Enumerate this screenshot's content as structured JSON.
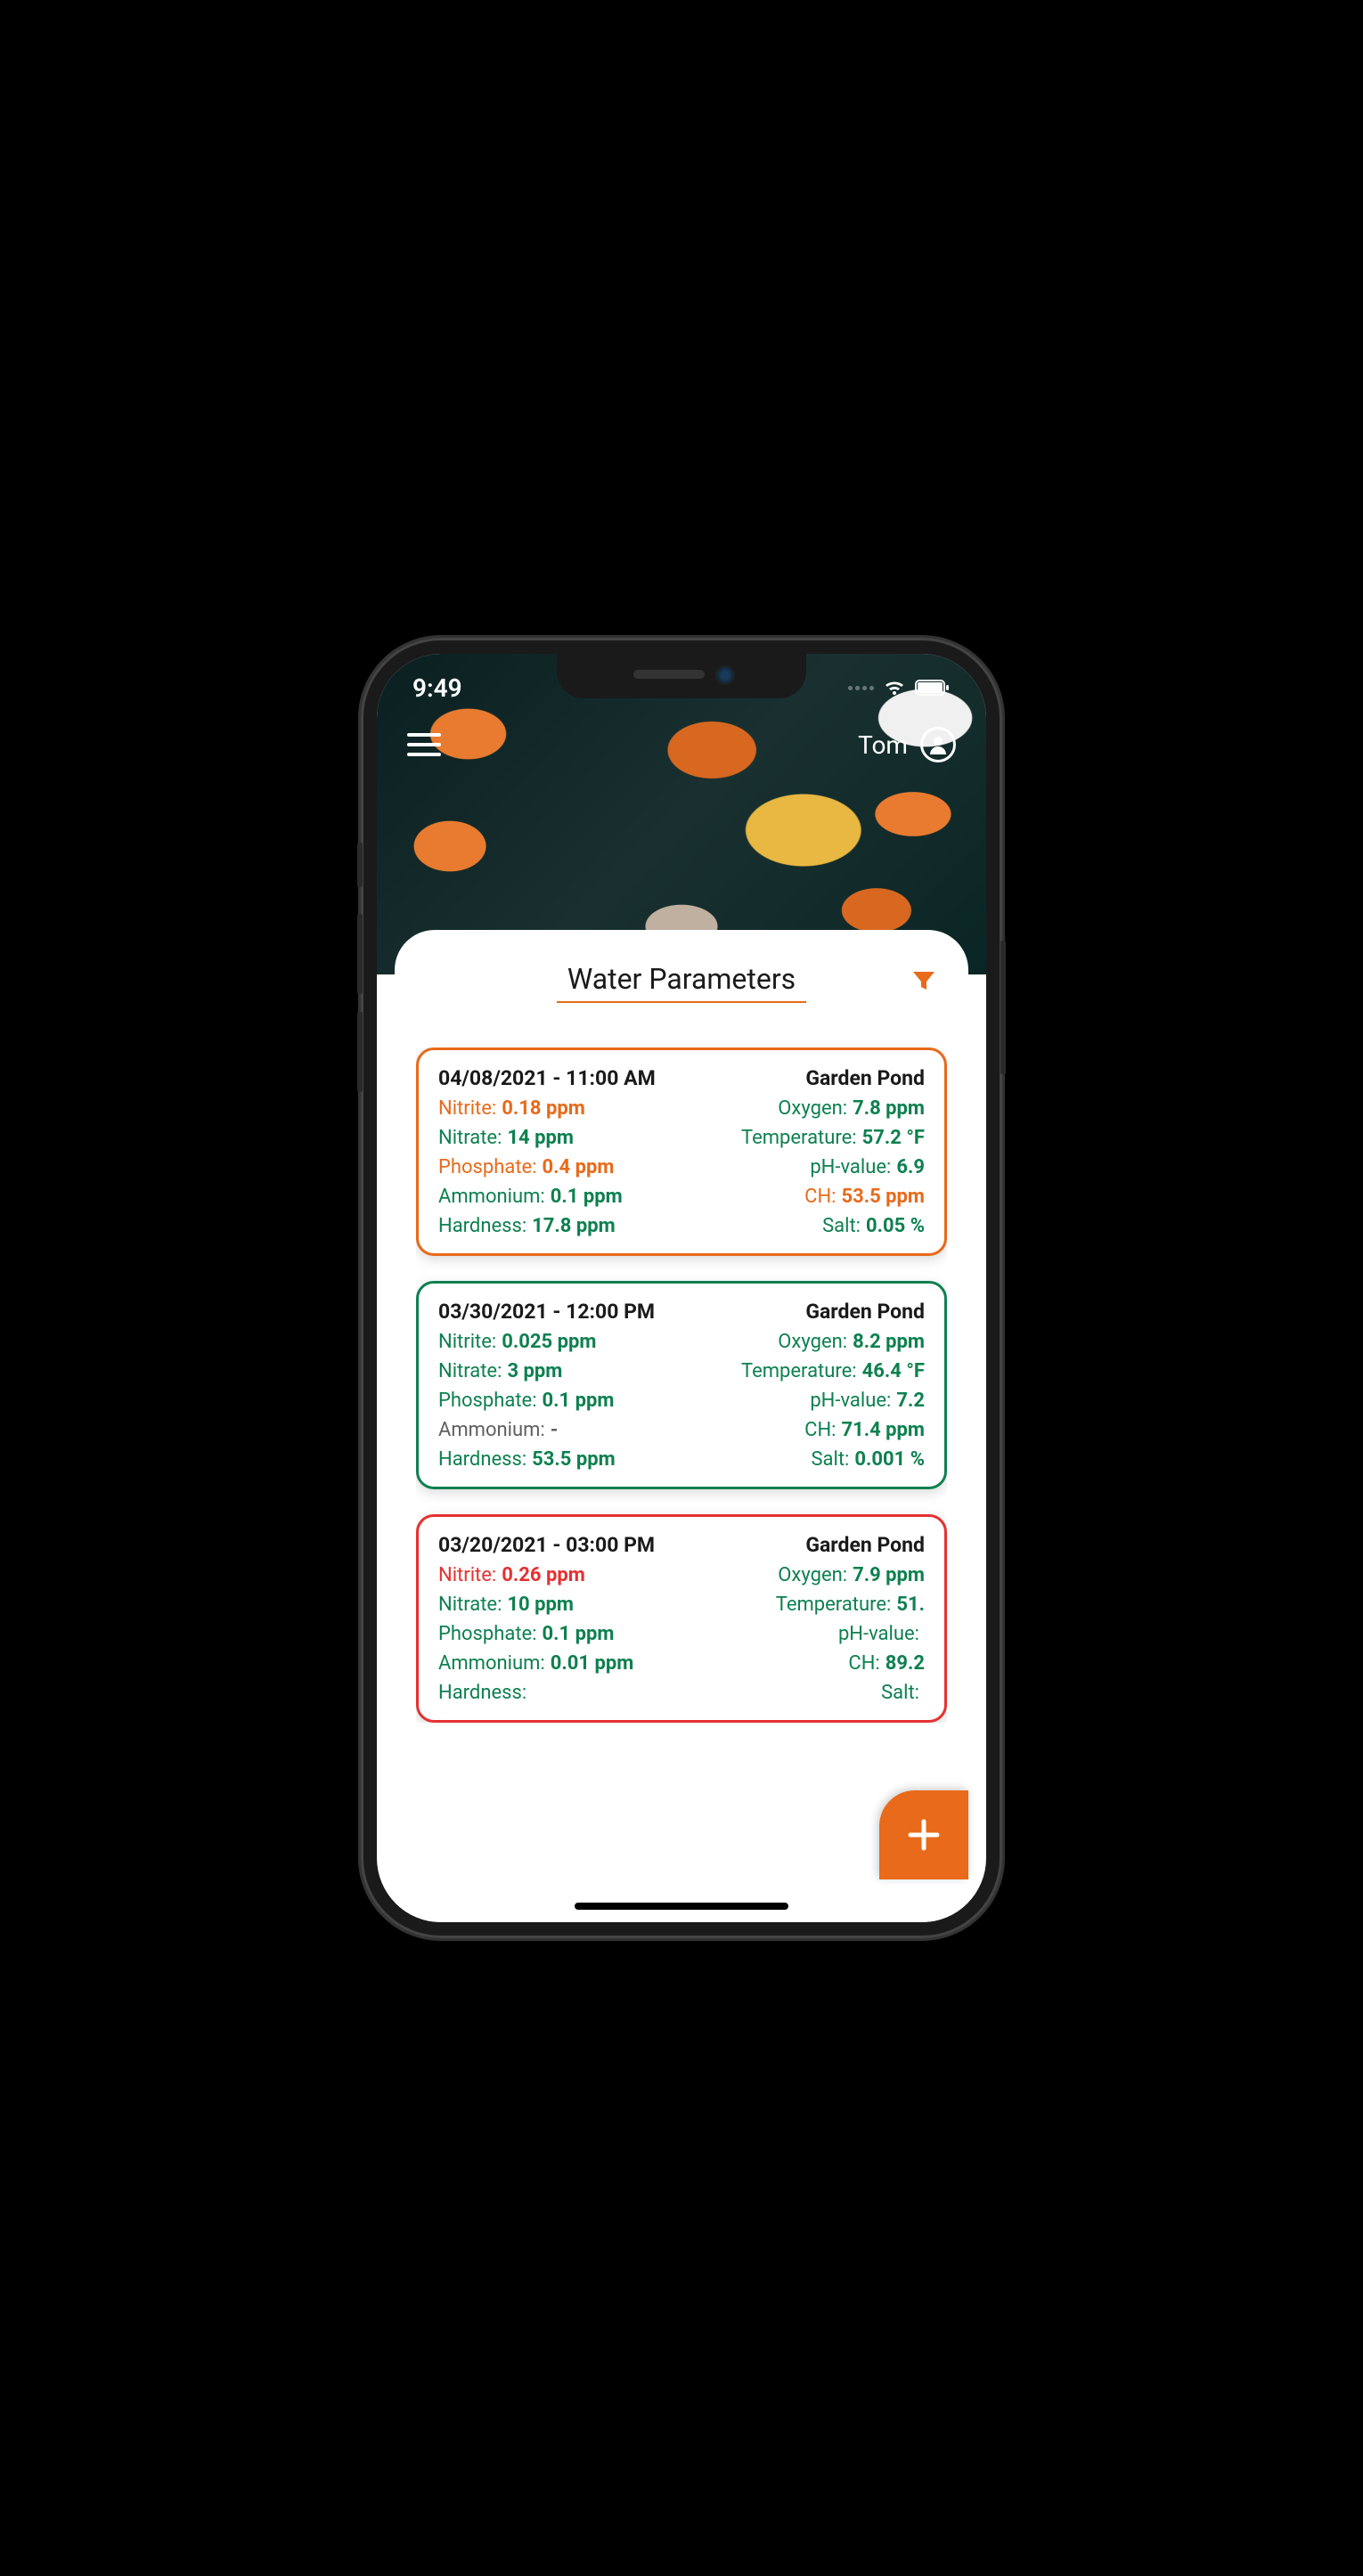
{
  "status": {
    "time": "9:49"
  },
  "nav": {
    "user_name": "Tom"
  },
  "sheet": {
    "title": "Water Parameters"
  },
  "labels": {
    "nitrite": "Nitrite:",
    "nitrate": "Nitrate:",
    "phosphate": "Phosphate:",
    "ammonium": "Ammonium:",
    "hardness": "Hardness:",
    "oxygen": "Oxygen:",
    "temperature": "Temperature:",
    "ph": "pH-value:",
    "ch": "CH:",
    "salt": "Salt:"
  },
  "records": [
    {
      "datetime": "04/08/2021 - 11:00 AM",
      "pond": "Garden Pond",
      "border": "orange",
      "nitrite": {
        "value": "0.18 ppm",
        "status": "orange"
      },
      "nitrate": {
        "value": "14 ppm",
        "status": "green"
      },
      "phosphate": {
        "value": "0.4 ppm",
        "status": "orange"
      },
      "ammonium": {
        "value": "0.1 ppm",
        "status": "green"
      },
      "hardness": {
        "value": "17.8 ppm",
        "status": "green"
      },
      "oxygen": {
        "value": "7.8 ppm",
        "status": "green"
      },
      "temperature": {
        "value": "57.2 °F",
        "status": "green"
      },
      "ph": {
        "value": "6.9",
        "status": "green"
      },
      "ch": {
        "value": "53.5 ppm",
        "status": "orange"
      },
      "salt": {
        "value": "0.05 %",
        "status": "green"
      }
    },
    {
      "datetime": "03/30/2021 - 12:00 PM",
      "pond": "Garden Pond",
      "border": "green",
      "nitrite": {
        "value": "0.025 ppm",
        "status": "green"
      },
      "nitrate": {
        "value": "3 ppm",
        "status": "green"
      },
      "phosphate": {
        "value": "0.1 ppm",
        "status": "green"
      },
      "ammonium": {
        "value": "-",
        "status": "gray"
      },
      "hardness": {
        "value": "53.5 ppm",
        "status": "green"
      },
      "oxygen": {
        "value": "8.2 ppm",
        "status": "green"
      },
      "temperature": {
        "value": "46.4 °F",
        "status": "green"
      },
      "ph": {
        "value": "7.2",
        "status": "green"
      },
      "ch": {
        "value": "71.4 ppm",
        "status": "green"
      },
      "salt": {
        "value": "0.001 %",
        "status": "green"
      }
    },
    {
      "datetime": "03/20/2021 - 03:00 PM",
      "pond": "Garden Pond",
      "border": "red",
      "nitrite": {
        "value": "0.26 ppm",
        "status": "red"
      },
      "nitrate": {
        "value": "10 ppm",
        "status": "green"
      },
      "phosphate": {
        "value": "0.1 ppm",
        "status": "green"
      },
      "ammonium": {
        "value": "0.01 ppm",
        "status": "green"
      },
      "hardness": {
        "value": "",
        "status": "green"
      },
      "oxygen": {
        "value": "7.9 ppm",
        "status": "green"
      },
      "temperature": {
        "value": "51.",
        "status": "green"
      },
      "ph": {
        "value": "",
        "status": "green"
      },
      "ch": {
        "value": "89.2",
        "status": "green"
      },
      "salt": {
        "value": "",
        "status": "green"
      }
    }
  ]
}
